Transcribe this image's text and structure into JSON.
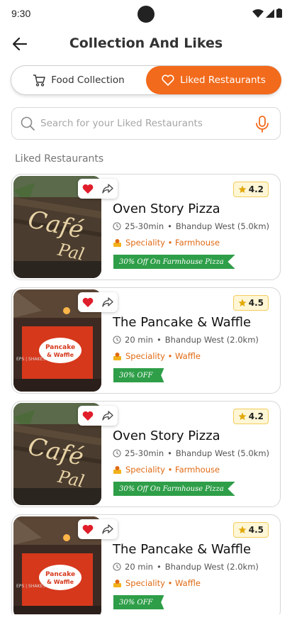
{
  "status": {
    "time": "9:30"
  },
  "header": {
    "title": "Collection And Likes"
  },
  "tabs": [
    {
      "label": "Food Collection",
      "active": false
    },
    {
      "label": "Liked Restaurants",
      "active": true
    }
  ],
  "search": {
    "placeholder": "Search for your Liked Restaurants"
  },
  "section_label": "Liked Restaurants",
  "colors": {
    "accent": "#f26a1b",
    "offer_green": "#2e9e48",
    "heart_red": "#e01e2b",
    "rating_bg": "#fff6d6"
  },
  "restaurants": [
    {
      "name": "Oven Story Pizza",
      "rating": "4.2",
      "time": "25-30min",
      "location": "Bhandup West (5.0km)",
      "speciality": "Speciality • Farmhouse",
      "offer": "30% Off On Farmhouse Pizza",
      "image": "cafe-sign"
    },
    {
      "name": "The Pancake & Waffle",
      "rating": "4.5",
      "time": "20 min",
      "location": "Bhandup West (2.0km)",
      "speciality": "Speciality • Waffle",
      "offer": "30% OFF",
      "image": "pancake-sign"
    },
    {
      "name": "Oven Story Pizza",
      "rating": "4.2",
      "time": "25-30min",
      "location": "Bhandup West (5.0km)",
      "speciality": "Speciality • Farmhouse",
      "offer": "30% Off On Farmhouse Pizza",
      "image": "cafe-sign"
    },
    {
      "name": "The Pancake & Waffle",
      "rating": "4.5",
      "time": "20 min",
      "location": "Bhandup West (2.0km)",
      "speciality": "Speciality • Waffle",
      "offer": "30% OFF",
      "image": "pancake-sign"
    }
  ]
}
